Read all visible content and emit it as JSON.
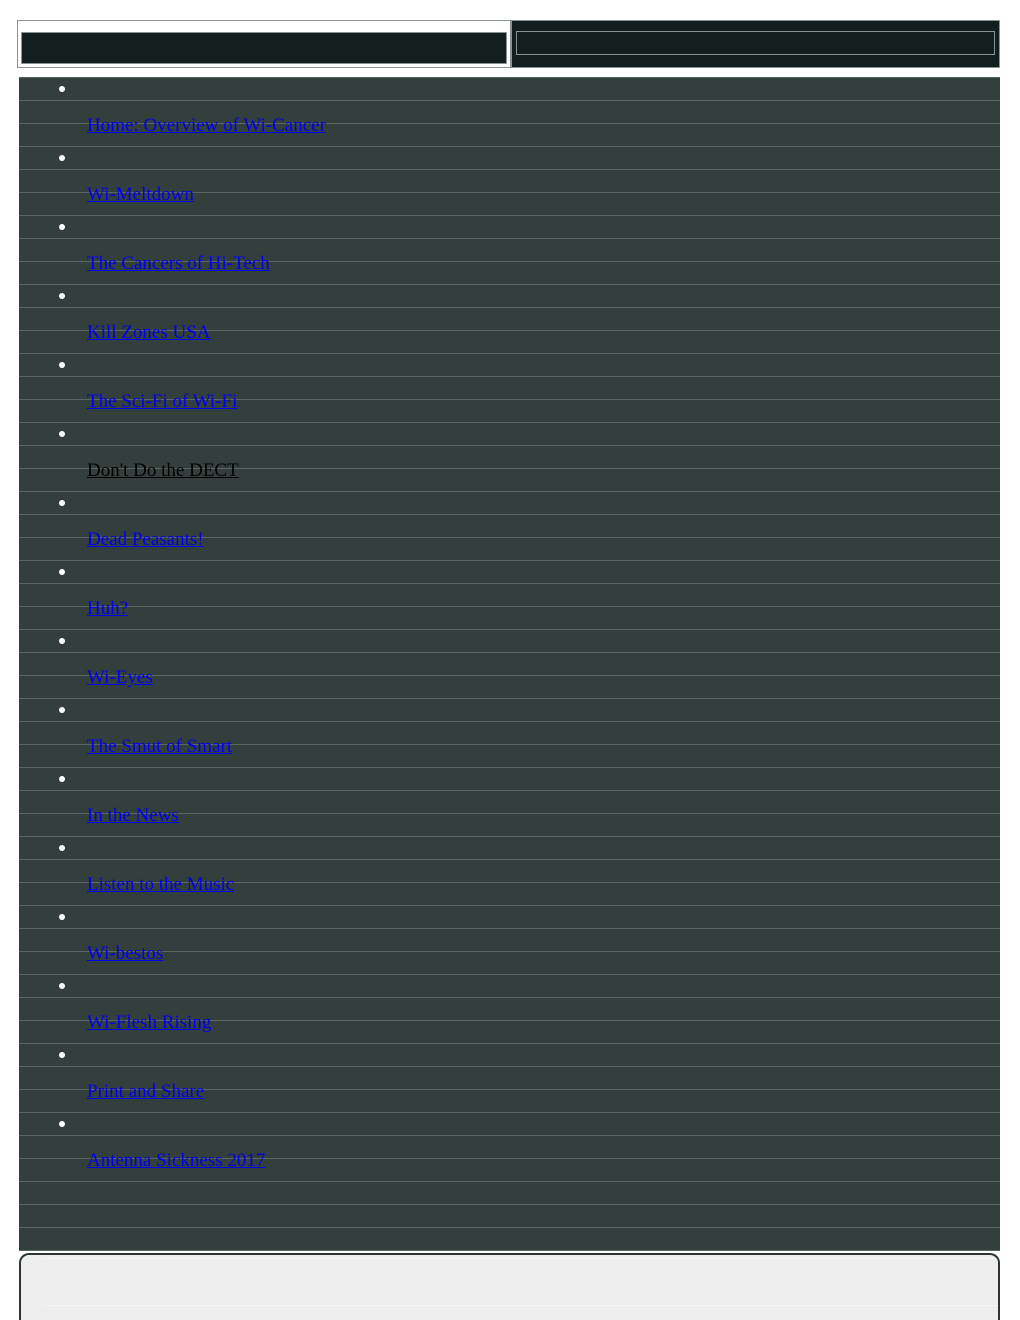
{
  "page": {
    "background_color": "#ffffff",
    "panel_color": "#333f3c",
    "rule_color": "#5a6663",
    "link_color": "#0000ee",
    "current_link_color": "#000000",
    "content_panel_color": "#eeeeee",
    "header_inner_color": "#131e1e"
  },
  "header": {
    "left_cell": {
      "label": ""
    },
    "right_cell": {
      "label": ""
    },
    "logo_slot": "",
    "banner_slot": "",
    "search_slot": ""
  },
  "nav": {
    "items": [
      {
        "label": "Home: Overview of Wi-Cancer",
        "current": false
      },
      {
        "label": "Wi-Meltdown",
        "current": false
      },
      {
        "label": "The Cancers of Hi-Tech",
        "current": false
      },
      {
        "label": "Kill Zones USA",
        "current": false
      },
      {
        "label": "The Sci-Fi of Wi-Fi",
        "current": false
      },
      {
        "label": "Don't Do the DECT",
        "current": true
      },
      {
        "label": "Dead Peasants!",
        "current": false
      },
      {
        "label": "Huh?",
        "current": false
      },
      {
        "label": "Wi-Eyes",
        "current": false
      },
      {
        "label": "The Smut of Smart",
        "current": false
      },
      {
        "label": "In the News",
        "current": false
      },
      {
        "label": "Listen to the Music",
        "current": false
      },
      {
        "label": "Wi-bestos",
        "current": false
      },
      {
        "label": "Wi-Flesh Rising",
        "current": false
      },
      {
        "label": "Print and Share",
        "current": false
      },
      {
        "label": "Antenna Sickness 2017",
        "current": false
      }
    ]
  },
  "content_panel": {
    "body_text": ""
  }
}
